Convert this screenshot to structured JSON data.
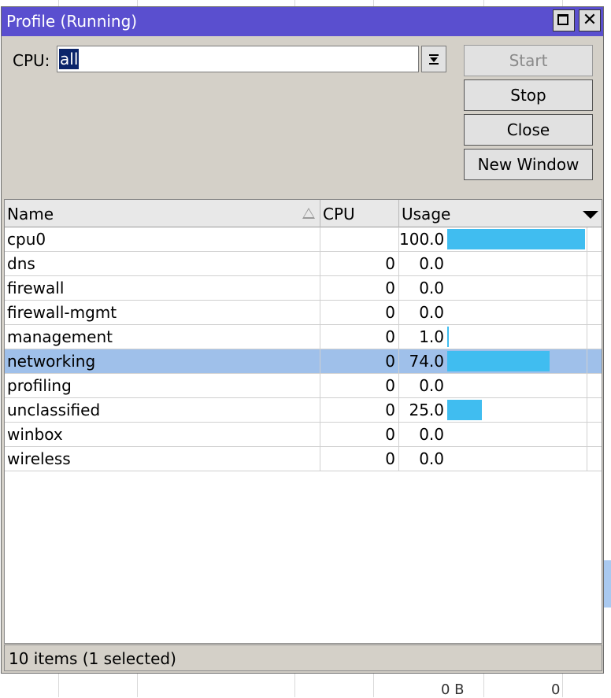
{
  "window": {
    "title": "Profile (Running)"
  },
  "cpu_filter": {
    "label": "CPU:",
    "value": "all"
  },
  "buttons": {
    "start": "Start",
    "stop": "Stop",
    "close": "Close",
    "new_window": "New Window"
  },
  "table": {
    "columns": {
      "name": "Name",
      "cpu": "CPU",
      "usage": "Usage"
    },
    "rows": [
      {
        "name": "cpu0",
        "cpu": "",
        "usage": "100.0",
        "usage_pct": 100,
        "selected": false
      },
      {
        "name": "dns",
        "cpu": "0",
        "usage": "0.0",
        "usage_pct": 0,
        "selected": false
      },
      {
        "name": "firewall",
        "cpu": "0",
        "usage": "0.0",
        "usage_pct": 0,
        "selected": false
      },
      {
        "name": "firewall-mgmt",
        "cpu": "0",
        "usage": "0.0",
        "usage_pct": 0,
        "selected": false
      },
      {
        "name": "management",
        "cpu": "0",
        "usage": "1.0",
        "usage_pct": 1,
        "selected": false
      },
      {
        "name": "networking",
        "cpu": "0",
        "usage": "74.0",
        "usage_pct": 74,
        "selected": true
      },
      {
        "name": "profiling",
        "cpu": "0",
        "usage": "0.0",
        "usage_pct": 0,
        "selected": false
      },
      {
        "name": "unclassified",
        "cpu": "0",
        "usage": "25.0",
        "usage_pct": 25,
        "selected": false
      },
      {
        "name": "winbox",
        "cpu": "0",
        "usage": "0.0",
        "usage_pct": 0,
        "selected": false
      },
      {
        "name": "wireless",
        "cpu": "0",
        "usage": "0.0",
        "usage_pct": 0,
        "selected": false
      }
    ]
  },
  "status": {
    "text": "10 items (1 selected)"
  },
  "background": {
    "bottom_size": "0 B",
    "bottom_count": "0"
  },
  "colors": {
    "titlebar": "#5a4fcf",
    "usage_bar": "#40bdf0",
    "selected_row": "#9fc0ea"
  }
}
